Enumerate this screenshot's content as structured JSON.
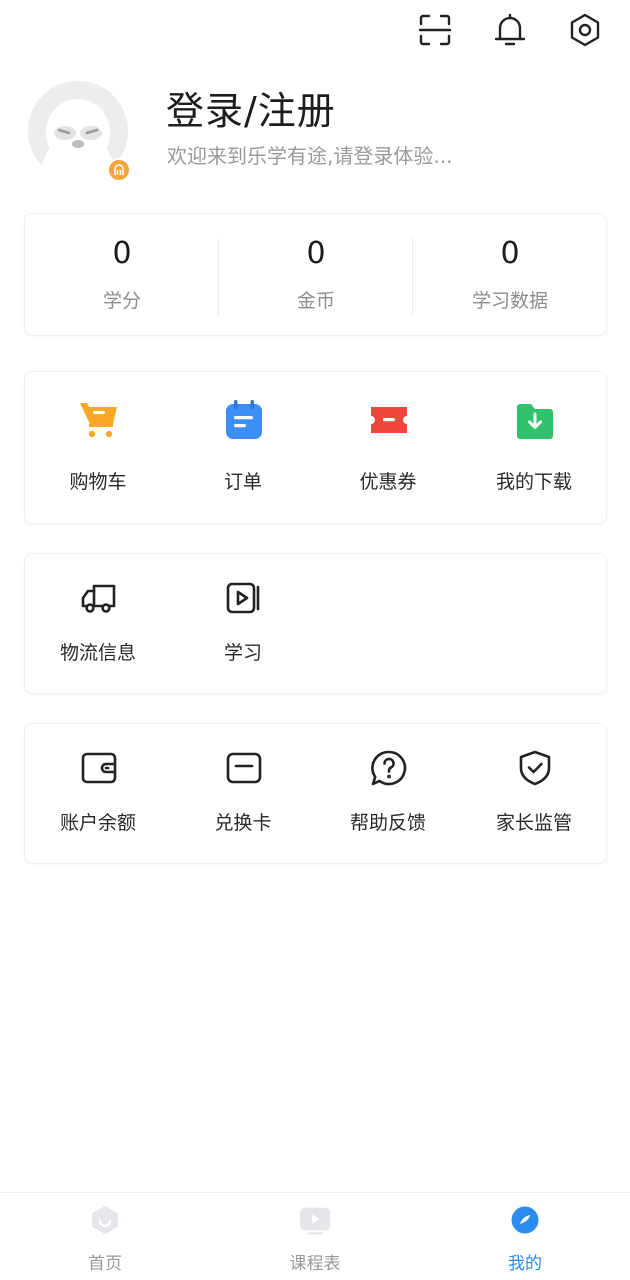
{
  "profile": {
    "login_title": "登录/注册",
    "welcome_text": "欢迎来到乐学有途,请登录体验..."
  },
  "stats": [
    {
      "value": "0",
      "label": "学分"
    },
    {
      "value": "0",
      "label": "金币"
    },
    {
      "value": "0",
      "label": "学习数据"
    }
  ],
  "shop_section": [
    {
      "label": "购物车",
      "icon": "shopping-cart-icon",
      "color": "#f9a825"
    },
    {
      "label": "订单",
      "icon": "order-calendar-icon",
      "color": "#3d8ef7"
    },
    {
      "label": "优惠券",
      "icon": "coupon-ticket-icon",
      "color": "#f0463c"
    },
    {
      "label": "我的下载",
      "icon": "download-folder-icon",
      "color": "#2fc26a"
    }
  ],
  "study_section": [
    {
      "label": "物流信息",
      "icon": "delivery-truck-icon"
    },
    {
      "label": "学习",
      "icon": "video-play-icon"
    }
  ],
  "account_section": [
    {
      "label": "账户余额",
      "icon": "wallet-icon"
    },
    {
      "label": "兑换卡",
      "icon": "card-icon"
    },
    {
      "label": "帮助反馈",
      "icon": "help-question-icon"
    },
    {
      "label": "家长监管",
      "icon": "shield-check-icon"
    }
  ],
  "tabbar": {
    "home": "首页",
    "schedule": "课程表",
    "mine": "我的",
    "active_color": "#2b8cf0"
  }
}
